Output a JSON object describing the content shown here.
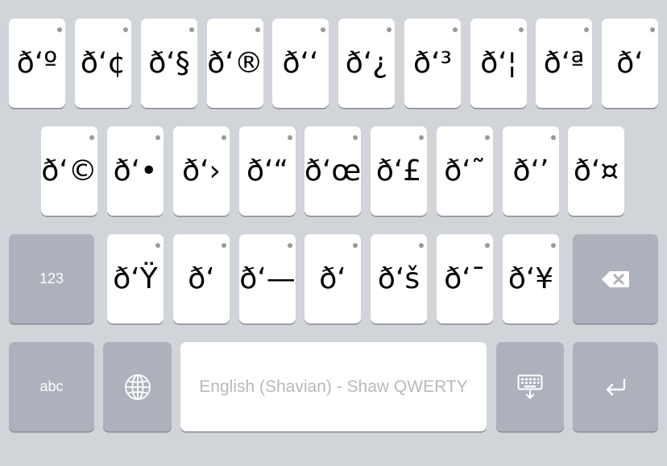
{
  "keyboard": {
    "row1": [
      "ð‘º",
      "ð‘¢",
      "ð‘§",
      "ð‘®",
      "ð‘‘",
      "ð‘¿",
      "ð‘³",
      "ð‘¦",
      "ð‘ª",
      "ð‘"
    ],
    "row2": [
      "ð‘©",
      "ð‘•",
      "ð‘›",
      "ð‘“",
      "ð‘œ",
      "ð‘£",
      "ð‘˜",
      "ð‘’",
      "ð‘¤"
    ],
    "row3": [
      "ð‘Ÿ",
      "ð‘",
      "ð‘—",
      "ð‘",
      "ð‘š",
      "ð‘¯",
      "ð‘¥"
    ],
    "numbers_label": "123",
    "abc_label": "abc",
    "space_label": "English (Shavian) - Shaw QWERTY",
    "icons": {
      "globe": "globe-icon",
      "delete": "backspace-icon",
      "dismiss": "keyboard-dismiss-icon",
      "return": "return-icon"
    },
    "colors": {
      "background": "#d1d4d9",
      "char_key": "#ffffff",
      "function_key": "#adb1bb",
      "space_text": "#b9b9bd"
    }
  }
}
